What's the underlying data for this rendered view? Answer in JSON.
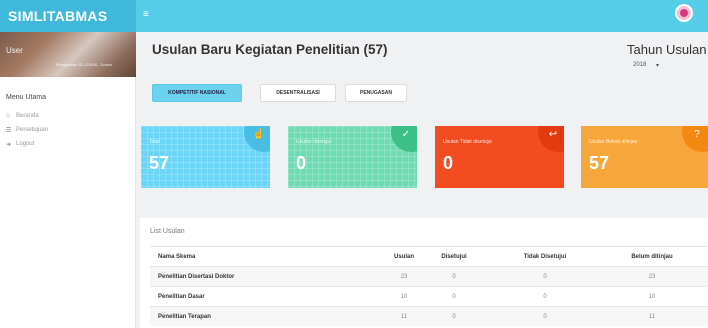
{
  "app": {
    "brand": "SIMLITABMAS"
  },
  "user": {
    "name": "User",
    "role": "Pengabdian ID 123456 - Dosen"
  },
  "sidebar": {
    "heading": "Menu Utama",
    "items": [
      {
        "label": "Beranda",
        "icon": "home-icon"
      },
      {
        "label": "Persetujuan",
        "icon": "checklist-icon"
      },
      {
        "label": "Logout",
        "icon": "logout-icon"
      }
    ]
  },
  "header": {
    "title": "Usulan Baru Kegiatan Penelitian (57)",
    "year_label": "Tahun Usulan",
    "year_value": "2018"
  },
  "tabs": [
    {
      "label": "KOMPETITIF NASIONAL",
      "active": true
    },
    {
      "label": "DESENTRALISASI",
      "active": false
    },
    {
      "label": "PENUGASAN",
      "active": false
    }
  ],
  "cards": [
    {
      "label": "Total",
      "value": "57",
      "icon": "hand-icon",
      "color": "#6cd5f5"
    },
    {
      "label": "Usulan disetujui",
      "value": "0",
      "icon": "check-circle-icon",
      "color": "#6ddbb3"
    },
    {
      "label": "Usulan Tidak disetujui",
      "value": "0",
      "icon": "reply-icon",
      "color": "#f24d21"
    },
    {
      "label": "Usulan Belum ditinjau",
      "value": "57",
      "icon": "question-circle-icon",
      "color": "#f7a63a"
    }
  ],
  "list": {
    "title": "List Usulan",
    "columns": [
      "Nama Skema",
      "Usulan",
      "Disetujui",
      "Tidak Disetujui",
      "Belum ditinjau"
    ],
    "rows": [
      [
        "Penelitian Disertasi Doktor",
        "23",
        "0",
        "0",
        "23"
      ],
      [
        "Penelitian Dasar",
        "10",
        "0",
        "0",
        "10"
      ],
      [
        "Penelitian Terapan",
        "11",
        "0",
        "0",
        "11"
      ]
    ]
  }
}
